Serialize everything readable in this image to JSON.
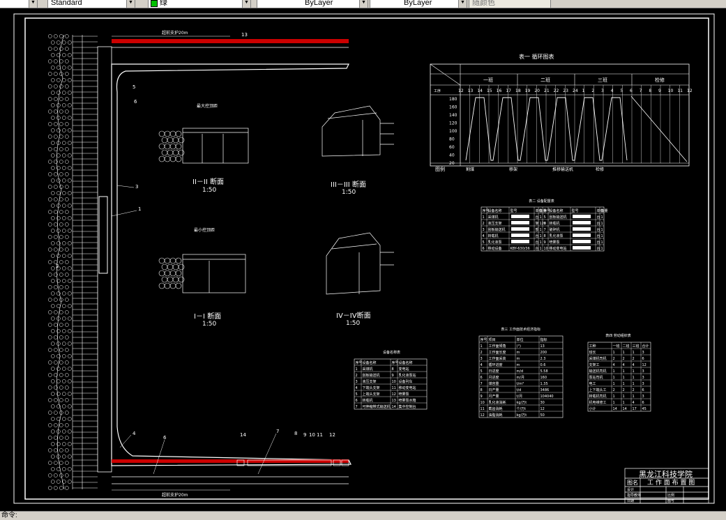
{
  "toolbar": {
    "style_combo": "Standard",
    "color_combo": "绿",
    "linetype_combo": "ByLayer",
    "lineweight_combo": "ByLayer",
    "plotstyle_combo": "随颜色"
  },
  "drawing": {
    "sections": {
      "s2_title": "II－II 断面",
      "s2_scale": "1:50",
      "s3_title": "III－III 断面",
      "s3_scale": "1:50",
      "s1_title": "I－I 断面",
      "s1_scale": "1:50",
      "s4_title": "IV－IV断面",
      "s4_scale": "1:50",
      "max_hold": "最大控顶距",
      "min_hold": "最小控顶距"
    },
    "callouts": {
      "n1": "1",
      "n2": "2",
      "n3": "3",
      "n4": "4",
      "n5": "5",
      "n6": "6",
      "n7": "7",
      "n8": "8",
      "n9": "9",
      "n10": "10",
      "n11": "11",
      "n12": "12",
      "n13": "13",
      "n14": "14"
    },
    "top_dim": "超前支护20m",
    "bottom_dim": "超前支护20m",
    "cycle_table": {
      "title": "表一  循环图表",
      "shifts": [
        "一班",
        "二班",
        "三班",
        "检修"
      ],
      "row_label": "工序",
      "y_ticks": [
        "180",
        "160",
        "140",
        "120",
        "100",
        "80",
        "60",
        "40",
        "20"
      ],
      "hours": [
        "12",
        "13",
        "14",
        "15",
        "16",
        "17",
        "18",
        "19",
        "20",
        "21",
        "22",
        "23",
        "24",
        "1",
        "2",
        "3",
        "4",
        "5",
        "6",
        "7",
        "8",
        "9",
        "10",
        "11",
        "12"
      ],
      "legend_label": "图例",
      "legend_items": [
        "割煤",
        "移架",
        "推移输送机",
        "检修"
      ]
    },
    "equip_table": {
      "title": "表二  设备配置表",
      "headers": [
        "序号",
        "设备名称",
        "型号",
        "单位",
        "数量",
        "序号",
        "设备名称",
        "型号",
        "单位",
        "数量"
      ],
      "rows": [
        [
          "1",
          "采煤机",
          "",
          "台",
          "1",
          "5",
          "刮板输送机",
          "",
          "台",
          "1"
        ],
        [
          "2",
          "液压支架",
          "",
          "架",
          "120",
          "6",
          "转载机",
          "",
          "台",
          "1"
        ],
        [
          "3",
          "刮板输送机",
          "",
          "部",
          "1",
          "7",
          "破碎机",
          "",
          "台",
          "1"
        ],
        [
          "4",
          "转载机",
          "",
          "台",
          "1",
          "8",
          "乳化液泵",
          "",
          "台",
          "1"
        ],
        [
          "5",
          "乳化液泵",
          "",
          "台",
          "1",
          "9",
          "喷雾泵",
          "",
          "台",
          "1"
        ],
        [
          "6",
          "移动设备",
          "KBY-630/36",
          "台",
          "1",
          "10",
          "移动变电站",
          "",
          "台",
          "1"
        ]
      ]
    },
    "device_list": {
      "title": "设备名称表",
      "headers": [
        "序号",
        "设备名称",
        "序号",
        "设备名称"
      ],
      "rows": [
        [
          "1",
          "采煤机",
          "8",
          "变电站"
        ],
        [
          "2",
          "刮板输送机",
          "9",
          "乳化液泵站"
        ],
        [
          "3",
          "液压支架",
          "10",
          "设备列车"
        ],
        [
          "4",
          "下端头支架",
          "11",
          "移动变电站"
        ],
        [
          "5",
          "上端头支架",
          "12",
          "喷雾泵"
        ],
        [
          "6",
          "转载机",
          "13",
          "喷雾泵水箱"
        ],
        [
          "7",
          "可伸缩带式输送机",
          "14",
          "集中控制台"
        ]
      ]
    },
    "tech_table": {
      "title": "表三  工作面技术经济指标",
      "headers": [
        "序号",
        "项目",
        "单位",
        "指标"
      ],
      "rows": [
        [
          "1",
          "工作面倾角",
          "(°)",
          "13"
        ],
        [
          "2",
          "工作面长度",
          "m",
          "200"
        ],
        [
          "3",
          "工作面采高",
          "m",
          "2.3"
        ],
        [
          "4",
          "循环进度",
          "m",
          "0.6"
        ],
        [
          "5",
          "日进度",
          "m/d",
          "5.58"
        ],
        [
          "6",
          "月进度",
          "m/月",
          "160"
        ],
        [
          "7",
          "煤容重",
          "t/m³",
          "1.35"
        ],
        [
          "8",
          "日产量",
          "t/d",
          "3486"
        ],
        [
          "9",
          "月产量",
          "t/月",
          "104040"
        ],
        [
          "10",
          "乳化液消耗",
          "kg/万t",
          "30"
        ],
        [
          "11",
          "截齿消耗",
          "个/万t",
          "12"
        ],
        [
          "12",
          "油脂消耗",
          "kg/万t",
          "50"
        ]
      ]
    },
    "labor_table": {
      "title": "表四  劳动组织表",
      "headers": [
        "工种",
        "一班",
        "二班",
        "三班",
        "合计"
      ],
      "rows": [
        [
          "班长",
          "1",
          "1",
          "1",
          "3"
        ],
        [
          "采煤机司机",
          "2",
          "2",
          "2",
          "6"
        ],
        [
          "支架工",
          "4",
          "4",
          "4",
          "12"
        ],
        [
          "输送机司机",
          "1",
          "1",
          "1",
          "3"
        ],
        [
          "泵站司机",
          "1",
          "1",
          "1",
          "3"
        ],
        [
          "电工",
          "1",
          "1",
          "1",
          "3"
        ],
        [
          "上下端头工",
          "2",
          "2",
          "2",
          "6"
        ],
        [
          "转载机司机",
          "1",
          "1",
          "1",
          "3"
        ],
        [
          "机电维修工",
          "1",
          "1",
          "4",
          "6"
        ],
        [
          "小计",
          "14",
          "14",
          "17",
          "45"
        ]
      ]
    },
    "title_block": {
      "school": "黑龙江科技学院",
      "drawing_name_label": "图名",
      "drawing_name": "工 作 面 布 置 图",
      "designer_label": "设计",
      "checker_label": "指导教师",
      "date_label": "日期",
      "scale_label": "比例",
      "sheet_label": "图号"
    }
  },
  "status": {
    "command_prompt": "命令:"
  }
}
